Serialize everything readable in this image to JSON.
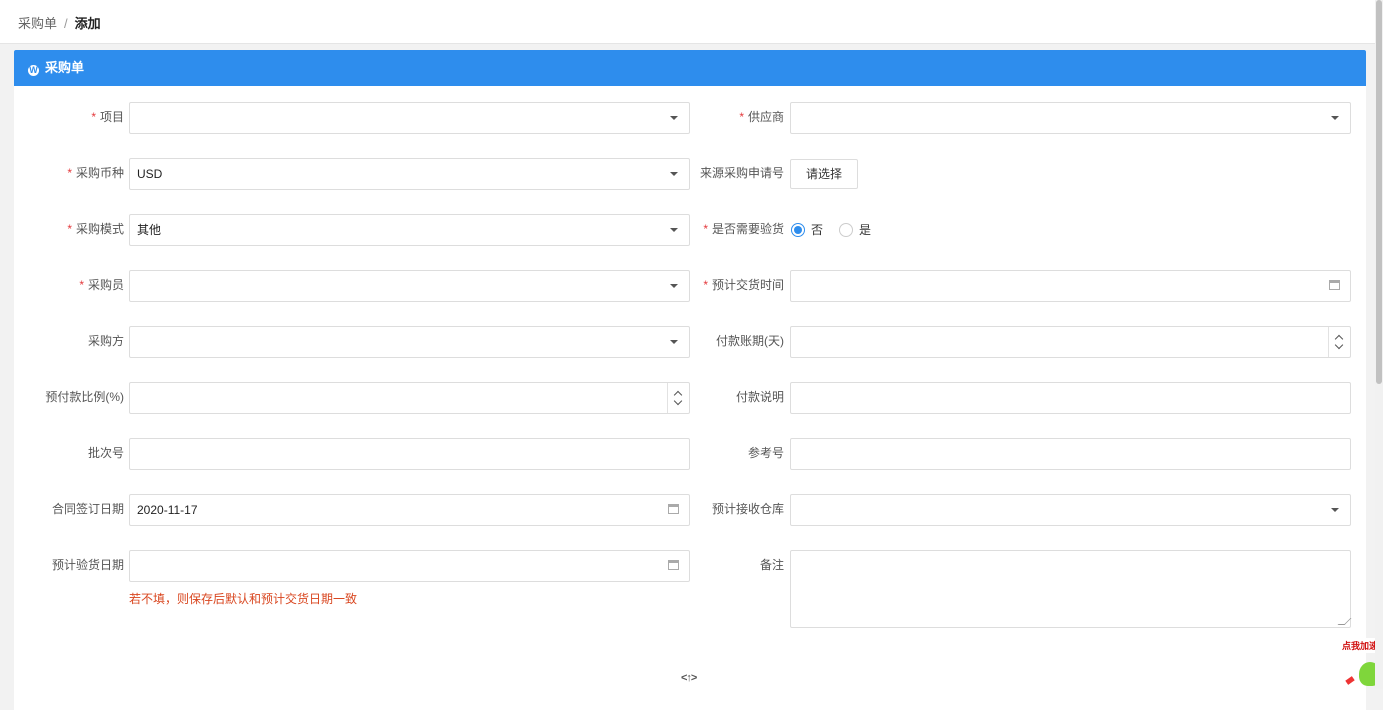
{
  "breadcrumb": {
    "parent": "采购单",
    "separator": "/",
    "current": "添加"
  },
  "card": {
    "title": "采购单",
    "icon": "wordpress-icon"
  },
  "form": {
    "project": {
      "label": "项目",
      "required": true,
      "value": ""
    },
    "supplier": {
      "label": "供应商",
      "required": true,
      "value": ""
    },
    "currency": {
      "label": "采购币种",
      "required": true,
      "value": "USD"
    },
    "source_request": {
      "label": "来源采购申请号",
      "required": false,
      "button": "请选择"
    },
    "purchase_mode": {
      "label": "采购模式",
      "required": true,
      "value": "其他"
    },
    "need_inspection": {
      "label": "是否需要验货",
      "required": true,
      "options": [
        "否",
        "是"
      ],
      "selected": "否"
    },
    "buyer": {
      "label": "采购员",
      "required": true,
      "value": ""
    },
    "expected_delivery": {
      "label": "预计交货时间",
      "required": true,
      "value": ""
    },
    "purchaser": {
      "label": "采购方",
      "required": false,
      "value": ""
    },
    "payment_days": {
      "label": "付款账期(天)",
      "required": false,
      "value": ""
    },
    "prepay_ratio": {
      "label": "预付款比例(%)",
      "required": false,
      "value": ""
    },
    "payment_note": {
      "label": "付款说明",
      "required": false,
      "value": ""
    },
    "batch_no": {
      "label": "批次号",
      "required": false,
      "value": ""
    },
    "reference_no": {
      "label": "参考号",
      "required": false,
      "value": ""
    },
    "contract_date": {
      "label": "合同签订日期",
      "required": false,
      "value": "2020-11-17"
    },
    "receiving_warehouse": {
      "label": "预计接收仓库",
      "required": false,
      "value": ""
    },
    "inspection_date": {
      "label": "预计验货日期",
      "required": false,
      "value": "",
      "hint": "若不填，则保存后默认和预计交货日期一致"
    },
    "remark": {
      "label": "备注",
      "required": false,
      "value": ""
    }
  },
  "footer": {
    "collapse_icon": "collapse-icon",
    "collapse_text": "<↑>"
  },
  "widget": {
    "text": "点我加速"
  },
  "colors": {
    "header": "#2e8ded",
    "required": "#e4393c",
    "hint": "#d9461f"
  }
}
